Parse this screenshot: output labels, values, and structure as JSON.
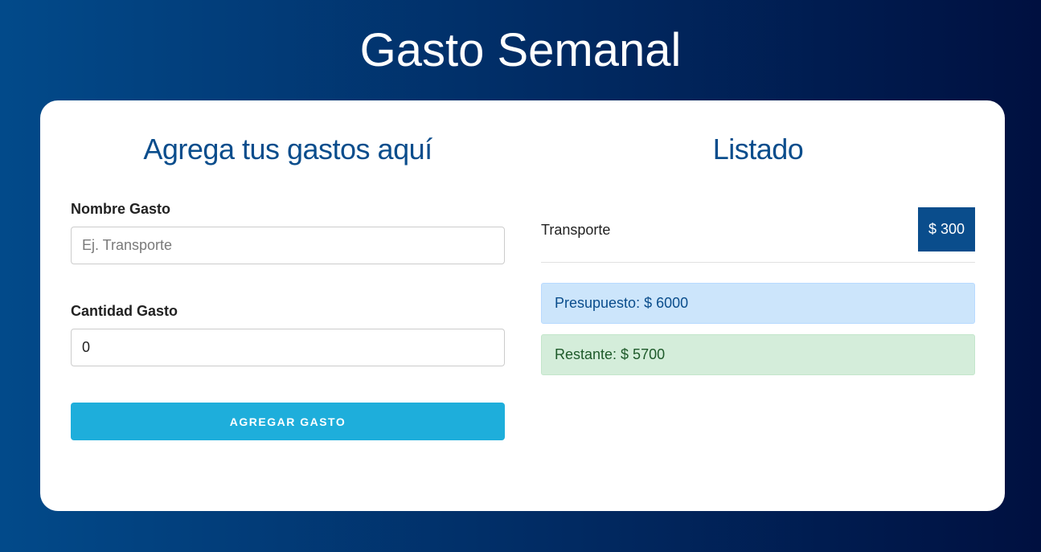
{
  "header": {
    "title": "Gasto Semanal"
  },
  "form": {
    "title": "Agrega tus gastos aquí",
    "name_label": "Nombre Gasto",
    "name_placeholder": "Ej. Transporte",
    "amount_label": "Cantidad Gasto",
    "amount_value": "0",
    "submit_label": "AGREGAR GASTO"
  },
  "listing": {
    "title": "Listado",
    "items": [
      {
        "name": "Transporte",
        "amount": "$ 300"
      }
    ],
    "budget_text": "Presupuesto: $ 6000",
    "remaining_text": "Restante: $ 5700"
  },
  "colors": {
    "primary": "#0a4d8c",
    "button": "#1eaedb",
    "budget_bg": "#cce5fb",
    "remaining_bg": "#d4edda"
  }
}
